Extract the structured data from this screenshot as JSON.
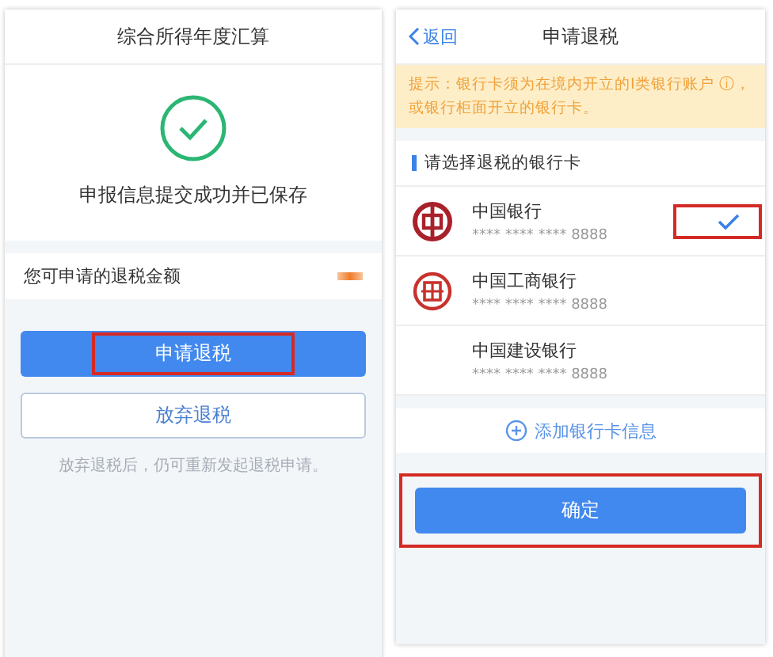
{
  "left_screen": {
    "title": "综合所得年度汇算",
    "success_message": "申报信息提交成功并已保存",
    "refund_row": {
      "label": "您可申请的退税金额",
      "amount_redacted": true
    },
    "buttons": [
      {
        "kind": "primary",
        "label": "申请退税",
        "highlighted": true
      },
      {
        "kind": "outline",
        "label": "放弃退税",
        "highlighted": false
      }
    ],
    "hint": "放弃退税后，仍可重新发起退税申请。"
  },
  "right_screen": {
    "back": "返回",
    "title": "申请退税",
    "notice": "提示：银行卡须为在境内开立的I类银行账户 ⓘ，或银行柜面开立的银行卡。",
    "section_title": "请选择退税的银行卡",
    "banks": [
      {
        "kind": "boc",
        "name": "中国银行",
        "card": "**** **** **** 8888",
        "selected": true,
        "highlighted": true
      },
      {
        "kind": "icbc",
        "name": "中国工商银行",
        "card": "**** **** **** 8888",
        "selected": false,
        "highlighted": false
      },
      {
        "kind": "plain",
        "name": "中国建设银行",
        "card": "**** **** **** 8888",
        "selected": false,
        "highlighted": false
      }
    ],
    "add_card": "添加银行卡信息",
    "confirm": {
      "label": "确定",
      "highlighted": true
    }
  }
}
